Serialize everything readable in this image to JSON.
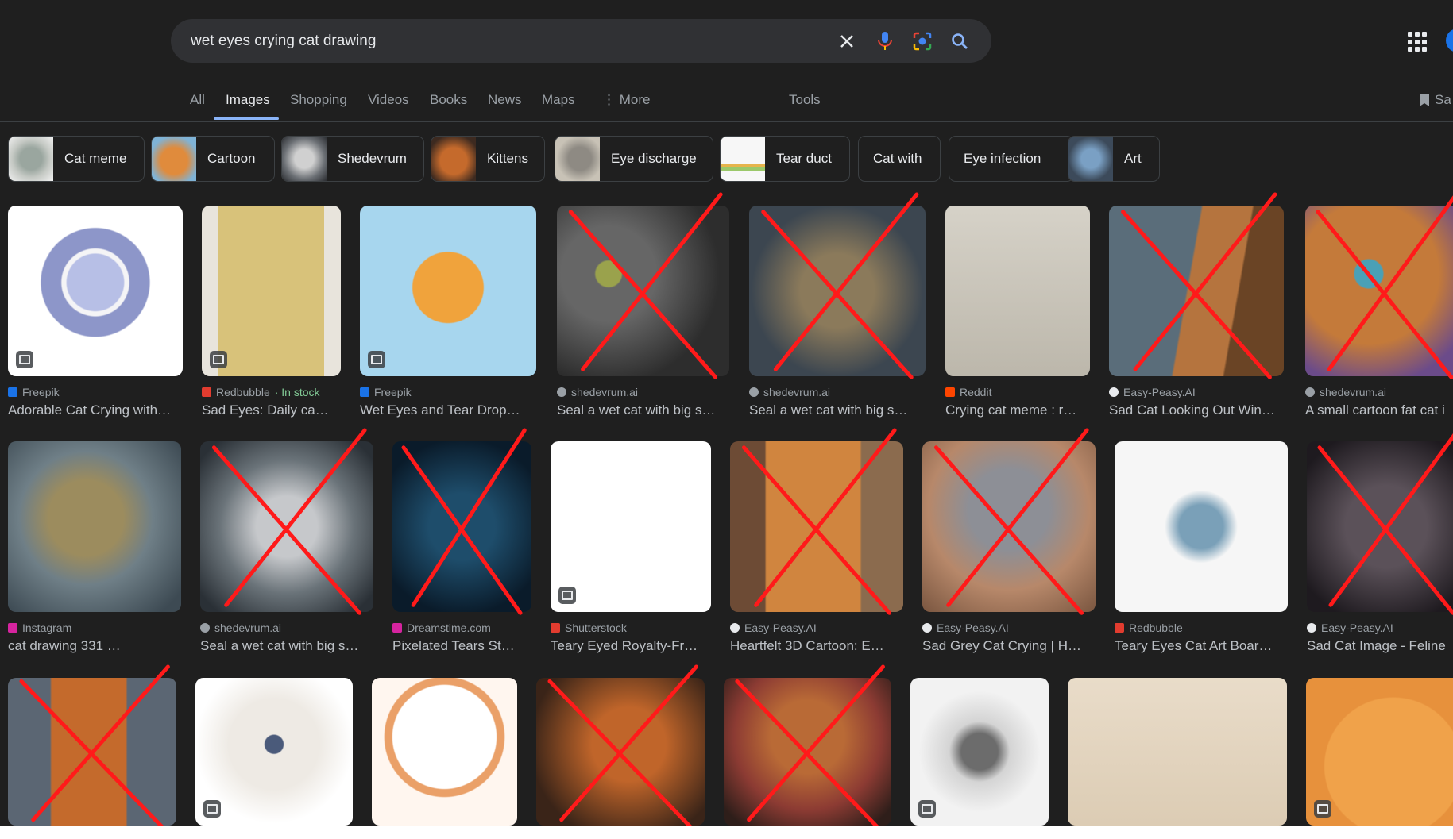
{
  "search": {
    "query": "wet eyes crying cat drawing"
  },
  "tabs": [
    "All",
    "Images",
    "Shopping",
    "Videos",
    "Books",
    "News",
    "Maps",
    "More",
    "Tools"
  ],
  "saved_label": "Sa",
  "chips": [
    {
      "label": "Cat meme"
    },
    {
      "label": "Cartoon"
    },
    {
      "label": "Shedevrum"
    },
    {
      "label": "Kittens"
    },
    {
      "label": "Eye discharge"
    },
    {
      "label": "Tear duct"
    },
    {
      "label": "Cat with"
    },
    {
      "label": "Eye infection"
    },
    {
      "label": "Art"
    }
  ],
  "results": [
    {
      "source": "Freepik",
      "title": "Adorable Cat Crying with…",
      "fav": "#1a73e8"
    },
    {
      "source": "Redbubble",
      "stock": "· In stock",
      "title": "Sad Eyes: Daily ca…",
      "fav": "#e23c2f"
    },
    {
      "source": "Freepik",
      "title": "Wet Eyes and Tear Drop…",
      "fav": "#1a73e8"
    },
    {
      "source": "shedevrum.ai",
      "title": "Seal a wet cat with big s…",
      "fav": "#9aa0a6"
    },
    {
      "source": "shedevrum.ai",
      "title": "Seal a wet cat with big s…",
      "fav": "#9aa0a6"
    },
    {
      "source": "Reddit",
      "title": "Crying cat meme : r…",
      "fav": "#ff4500"
    },
    {
      "source": "Easy-Peasy.AI",
      "title": "Sad Cat Looking Out Win…",
      "fav": "#e8eaed"
    },
    {
      "source": "shedevrum.ai",
      "title": "A small cartoon fat cat i",
      "fav": "#9aa0a6"
    },
    {
      "source": "Instagram",
      "title": "cat drawing 331 …",
      "fav": "#d6249f"
    },
    {
      "source": "shedevrum.ai",
      "title": "Seal a wet cat with big s…",
      "fav": "#9aa0a6"
    },
    {
      "source": "Dreamstime.com",
      "title": "Pixelated Tears St…",
      "fav": "#d6249f"
    },
    {
      "source": "Shutterstock",
      "title": "Teary Eyed Royalty-Fr…",
      "fav": "#e23c2f"
    },
    {
      "source": "Easy-Peasy.AI",
      "title": "Heartfelt 3D Cartoon: E…",
      "fav": "#e8eaed"
    },
    {
      "source": "Easy-Peasy.AI",
      "title": "Sad Grey Cat Crying | H…",
      "fav": "#e8eaed"
    },
    {
      "source": "Redbubble",
      "title": "Teary Eyes Cat Art Boar…",
      "fav": "#e23c2f"
    },
    {
      "source": "Easy-Peasy.AI",
      "title": "Sad Cat Image - Feline",
      "fav": "#e8eaed"
    },
    {
      "source": "",
      "title": ""
    },
    {
      "source": "",
      "title": ""
    },
    {
      "source": "",
      "title": ""
    },
    {
      "source": "",
      "title": ""
    },
    {
      "source": "",
      "title": ""
    },
    {
      "source": "",
      "title": ""
    },
    {
      "source": "",
      "title": ""
    },
    {
      "source": "",
      "title": ""
    }
  ],
  "colors": {
    "background": "#1f1f1f",
    "accent": "#8ab4f8",
    "cross": "#ff1a1a"
  }
}
